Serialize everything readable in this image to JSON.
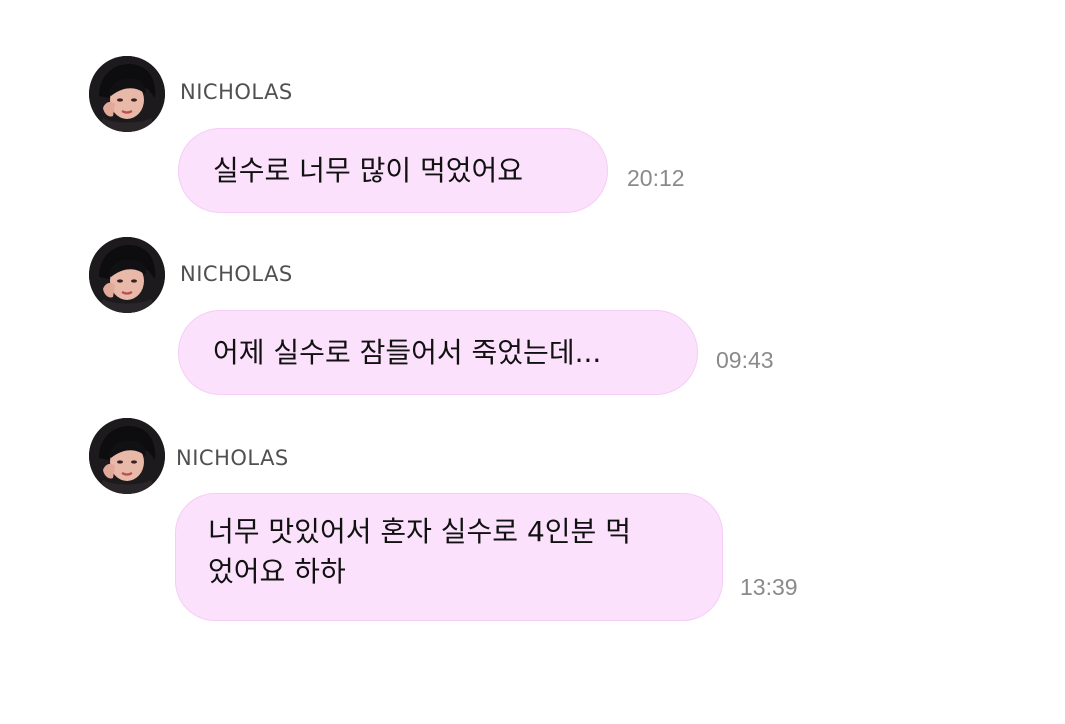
{
  "conversation": {
    "messages": [
      {
        "sender": "NICHOLAS",
        "avatar_icon": "profile-photo",
        "text": "실수로 너무 많이 먹었어요",
        "time": "20:12"
      },
      {
        "sender": "NICHOLAS",
        "avatar_icon": "profile-photo",
        "text": "어제 실수로 잠들어서 죽었는데...",
        "time": "09:43"
      },
      {
        "sender": "NICHOLAS",
        "avatar_icon": "profile-photo",
        "text": "너무 맛있어서 혼자 실수로 4인분 먹\n었어요 하하",
        "time": "13:39"
      }
    ]
  },
  "colors": {
    "bubble_background": "#fbe1fb",
    "bubble_border": "#f5cdf5",
    "sender_text": "#505050",
    "time_text": "#8a8a8a"
  }
}
